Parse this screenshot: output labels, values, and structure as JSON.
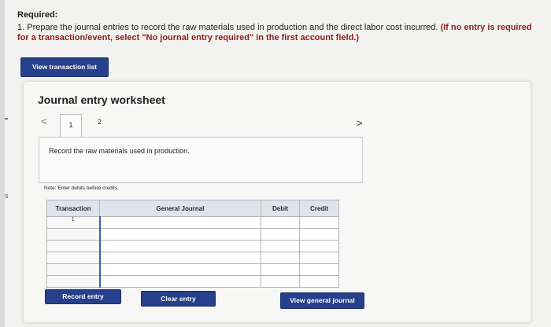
{
  "required": {
    "title": "Required:",
    "text": "1. Prepare the journal entries to record the raw materials used in production and the direct labor cost incurred. ",
    "red_text": "(If no entry is required for a transaction/event, select \"No journal entry required\" in the first account field.)"
  },
  "buttons": {
    "view_transaction_list": "View transaction list",
    "record_entry": "Record entry",
    "clear_entry": "Clear entry",
    "view_general_journal": "View general journal"
  },
  "worksheet": {
    "title": "Journal entry worksheet",
    "prev_glyph": "<",
    "next_glyph": ">",
    "tabs": [
      "1",
      "2"
    ],
    "description": "Record the raw materials used in production.",
    "note": "Note: Enter debits before credits."
  },
  "table": {
    "headers": {
      "transaction": "Transaction",
      "general_journal": "General Journal",
      "debit": "Debit",
      "credit": "Credit"
    },
    "rows": [
      {
        "transaction": "1"
      },
      {
        "transaction": ""
      },
      {
        "transaction": ""
      },
      {
        "transaction": ""
      },
      {
        "transaction": ""
      },
      {
        "transaction": ""
      }
    ]
  },
  "edge": {
    "mark": "s"
  }
}
